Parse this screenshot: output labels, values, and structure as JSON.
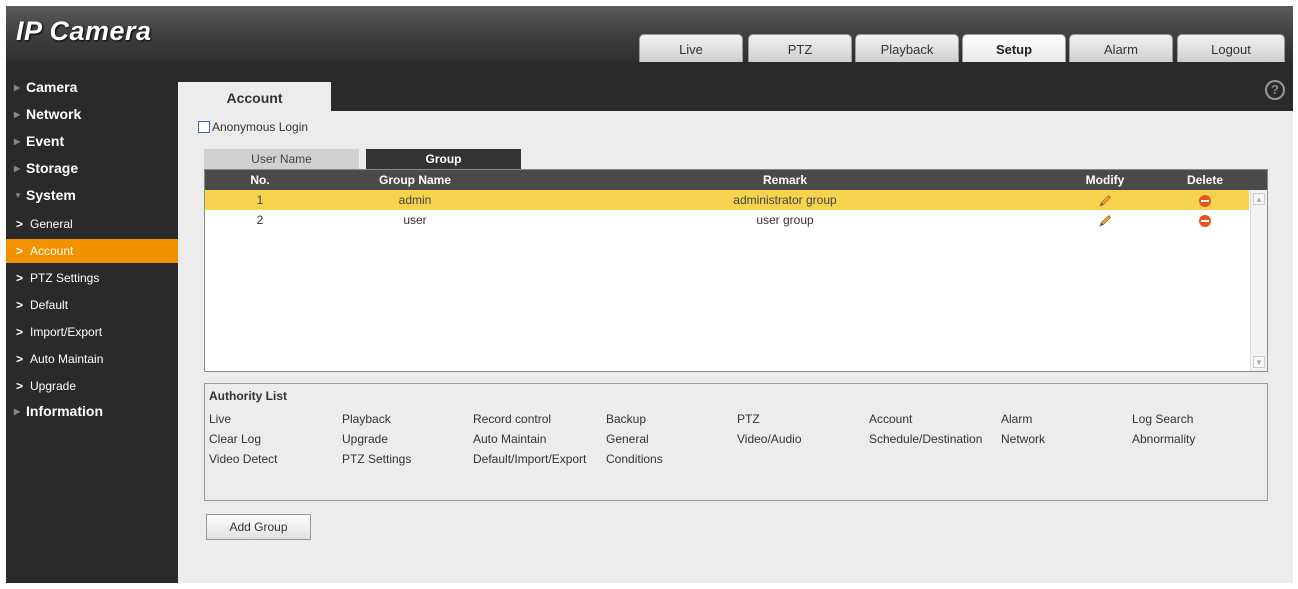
{
  "app": {
    "title": "IP Camera"
  },
  "nav": [
    {
      "label": "Live"
    },
    {
      "label": "PTZ"
    },
    {
      "label": "Playback"
    },
    {
      "label": "Setup",
      "active": true
    },
    {
      "label": "Alarm"
    },
    {
      "label": "Logout"
    }
  ],
  "sidebar": {
    "groups": [
      {
        "label": "Camera",
        "expanded": false
      },
      {
        "label": "Network",
        "expanded": false
      },
      {
        "label": "Event",
        "expanded": false
      },
      {
        "label": "Storage",
        "expanded": false
      },
      {
        "label": "System",
        "expanded": true,
        "items": [
          "General",
          "Account",
          "PTZ Settings",
          "Default",
          "Import/Export",
          "Auto Maintain",
          "Upgrade"
        ],
        "active_item": "Account"
      },
      {
        "label": "Information",
        "expanded": false
      }
    ]
  },
  "page": {
    "tab": "Account",
    "help_icon": "?",
    "anonymous_login": {
      "label": "Anonymous Login",
      "checked": false
    },
    "subtabs": [
      {
        "label": "User Name",
        "active": false
      },
      {
        "label": "Group",
        "active": true
      }
    ],
    "table": {
      "headers": {
        "no": "No.",
        "group_name": "Group Name",
        "remark": "Remark",
        "modify": "Modify",
        "delete": "Delete"
      },
      "rows": [
        {
          "no": "1",
          "group_name": "admin",
          "remark": "administrator group",
          "selected": true
        },
        {
          "no": "2",
          "group_name": "user",
          "remark": "user group",
          "selected": false
        }
      ]
    },
    "authority": {
      "title": "Authority List",
      "items": [
        "Live",
        "Playback",
        "Record control",
        "Backup",
        "PTZ",
        "Account",
        "Alarm",
        "Log Search",
        "Clear Log",
        "Upgrade",
        "Auto Maintain",
        "General",
        "Video/Audio",
        "Schedule/Destination",
        "Network",
        "Abnormality",
        "Video Detect",
        "PTZ Settings",
        "Default/Import/Export",
        "Conditions"
      ]
    },
    "add_group_label": "Add Group"
  },
  "colors": {
    "accent": "#f39200",
    "selected_row": "#f5d34e",
    "delete": "#e8541e"
  },
  "icons": {
    "modify": "pencil-icon",
    "delete": "delete-icon",
    "help": "help-icon"
  }
}
